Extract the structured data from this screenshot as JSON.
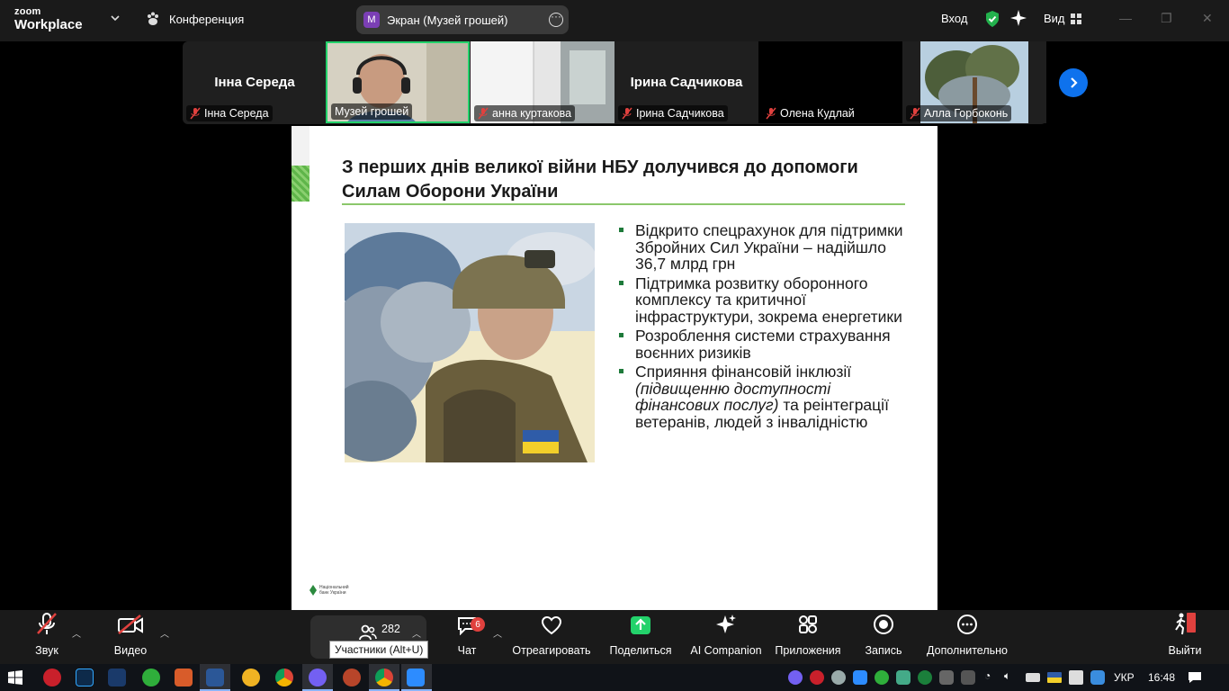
{
  "app": {
    "logo_top": "zoom",
    "logo_bottom": "Workplace",
    "conference_label": "Конференция",
    "screen_share_label": "Экран (Музей грошей)",
    "screen_share_avatar": "M",
    "enter_label": "Вход",
    "view_label": "Вид"
  },
  "participants": [
    {
      "display_name": "Інна Середа",
      "label": "Інна Середа",
      "muted": true,
      "video": false
    },
    {
      "display_name": "",
      "label": "Музей грошей",
      "muted": false,
      "video": true,
      "active": true
    },
    {
      "display_name": "",
      "label": "анна куртакова",
      "muted": true,
      "video": true
    },
    {
      "display_name": "Ірина Садчикова",
      "label": "Ірина Садчикова",
      "muted": true,
      "video": false
    },
    {
      "display_name": "",
      "label": "Олена Кудлай",
      "muted": true,
      "video": false
    },
    {
      "display_name": "",
      "label": "Алла Горбоконь",
      "muted": true,
      "video": true
    }
  ],
  "slide": {
    "title": "З перших днів великої війни НБУ долучився до допомоги Силам Оборони України",
    "bullets": [
      {
        "text": "Відкрито спецрахунок для підтримки Збройних Сил України – надійшло 36,7 млрд грн"
      },
      {
        "text": "Підтримка розвитку оборонного комплексу та критичної інфраструктури, зокрема енергетики"
      },
      {
        "text": "Розроблення системи страхування воєнних ризиків"
      },
      {
        "text_before": "Сприяння фінансовій інклюзії ",
        "text_italic": "(підвищенню доступності фінансових послуг)",
        "text_after": " та реінтеграції ветеранів, людей з інвалідністю"
      }
    ],
    "logo_text": "Національний банк України"
  },
  "toolbar": {
    "audio_label": "Звук",
    "video_label": "Видео",
    "participants_count": "282",
    "participants_tooltip": "Участники (Alt+U)",
    "chat_label": "Чат",
    "chat_badge": "6",
    "react_label": "Отреагировать",
    "share_label": "Поделиться",
    "ai_label": "AI Companion",
    "apps_label": "Приложения",
    "record_label": "Запись",
    "more_label": "Дополнительно",
    "leave_label": "Выйти"
  },
  "taskbar": {
    "lang": "УКР",
    "time": "16:48"
  },
  "colors": {
    "zoom_blue": "#0e72ed",
    "share_green": "#23d26b",
    "mute_red": "#e0413e",
    "slide_green": "#8bc76b"
  }
}
